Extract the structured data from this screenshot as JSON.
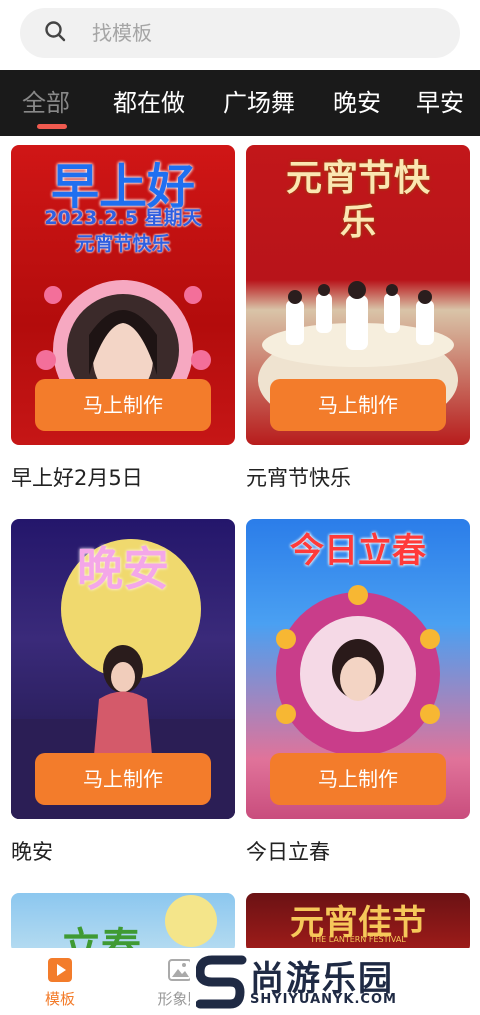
{
  "search": {
    "placeholder": "找模板"
  },
  "tabs": [
    {
      "label": "全部"
    },
    {
      "label": "都在做"
    },
    {
      "label": "广场舞"
    },
    {
      "label": "晚安"
    },
    {
      "label": "早安"
    }
  ],
  "cards": [
    {
      "caption": "早上好2月5日",
      "button": "马上制作",
      "art": {
        "title": "早上好",
        "line1": "2023.2.5 星期天",
        "line2": "元宵节快乐"
      }
    },
    {
      "caption": "元宵节快乐",
      "button": "马上制作",
      "art": {
        "title": "元宵节快乐"
      }
    },
    {
      "caption": "晚安",
      "button": "马上制作",
      "art": {
        "title": "晚安"
      }
    },
    {
      "caption": "今日立春",
      "button": "马上制作",
      "art": {
        "title": "今日立春"
      }
    },
    {
      "caption": "",
      "button": "",
      "art": {
        "title": "立春"
      }
    },
    {
      "caption": "",
      "button": "",
      "art": {
        "title": "元宵佳节",
        "sub": "THE LANTERN FESTIVAL"
      }
    }
  ],
  "bottom_nav": [
    {
      "label": "模板",
      "icon": "play-icon",
      "active": true
    },
    {
      "label": "形象照",
      "icon": "image-icon",
      "active": false
    }
  ],
  "watermark": {
    "text": "尚游乐园",
    "sub": "SHYIYUANYK.COM"
  },
  "colors": {
    "accent": "#f37c2b",
    "tab_indicator": "#f05a4f",
    "nav_active": "#f37c2b"
  }
}
